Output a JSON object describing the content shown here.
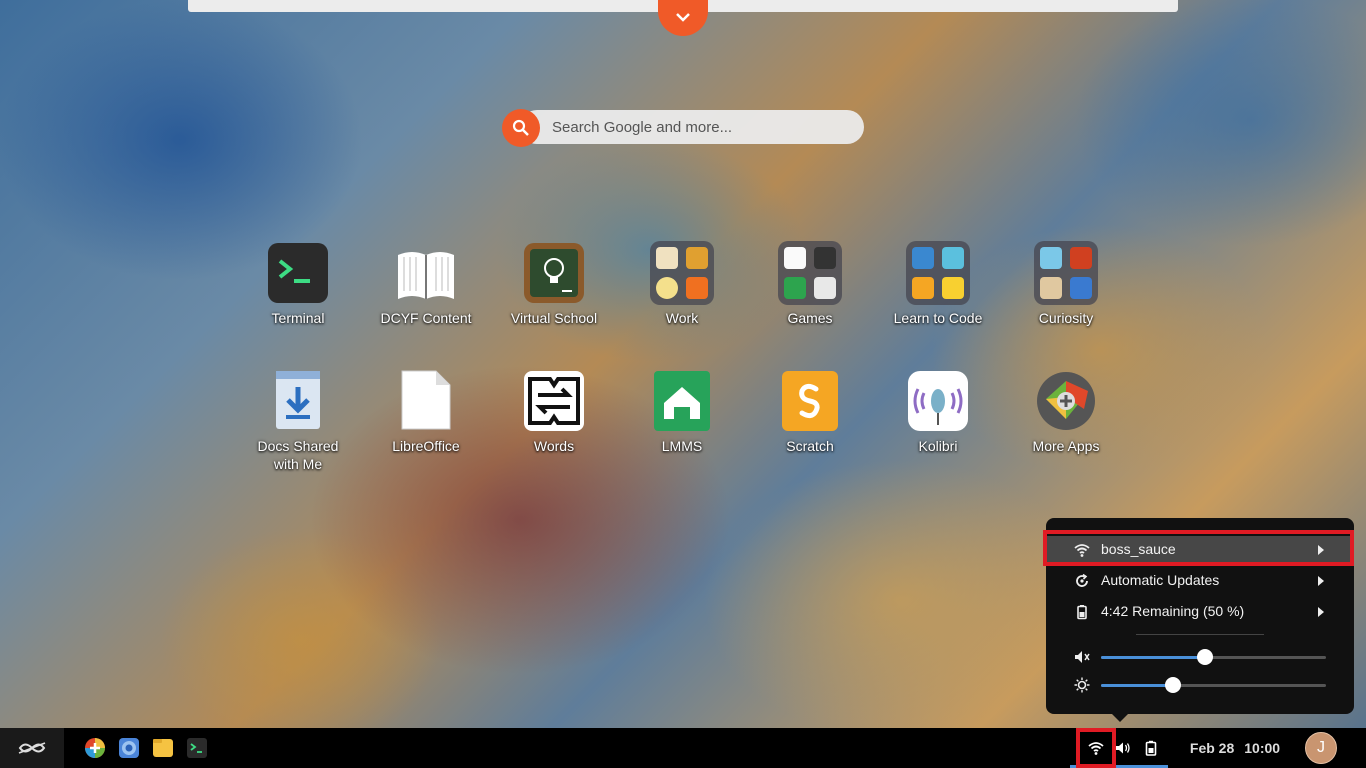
{
  "search": {
    "placeholder": "Search Google and more..."
  },
  "apps": {
    "row1": [
      {
        "label": "Terminal",
        "icon": "terminal-icon"
      },
      {
        "label": "DCYF Content",
        "icon": "book-icon"
      },
      {
        "label": "Virtual School",
        "icon": "lightbulb-board-icon"
      },
      {
        "label": "Work",
        "icon": "folder-icon"
      },
      {
        "label": "Games",
        "icon": "folder-icon"
      },
      {
        "label": "Learn to Code",
        "icon": "folder-icon"
      },
      {
        "label": "Curiosity",
        "icon": "folder-icon"
      }
    ],
    "row2": [
      {
        "label": "Docs Shared with Me",
        "icon": "download-doc-icon"
      },
      {
        "label": "LibreOffice",
        "icon": "document-icon"
      },
      {
        "label": "Words",
        "icon": "words-icon"
      },
      {
        "label": "LMMS",
        "icon": "lmms-icon"
      },
      {
        "label": "Scratch",
        "icon": "scratch-icon"
      },
      {
        "label": "Kolibri",
        "icon": "kolibri-icon"
      },
      {
        "label": "More Apps",
        "icon": "more-apps-icon"
      }
    ]
  },
  "system_menu": {
    "wifi": {
      "label": "boss_sauce",
      "icon": "wifi-icon"
    },
    "updates": {
      "label": "Automatic Updates",
      "icon": "sync-icon"
    },
    "battery": {
      "label": "4:42 Remaining (50 %)",
      "icon": "battery-icon"
    },
    "volume_level": 0.46,
    "brightness_level": 0.32
  },
  "taskbar": {
    "date": "Feb 28",
    "time": "10:00",
    "avatar_initial": "J"
  },
  "colors": {
    "accent": "#f05a28",
    "highlight": "#e01b24",
    "slider": "#4a90d9"
  }
}
